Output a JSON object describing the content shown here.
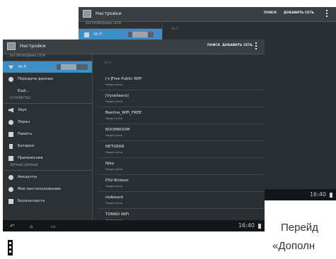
{
  "title": "Настройки",
  "actions": {
    "search": "ПОИСК",
    "add_network": "ДОБАВИТЬ СЕТЬ"
  },
  "clock": "16:40",
  "back_tablet": {
    "section": "БЕСПРОВОДНЫЕ СЕТИ",
    "wifi_label": "Wi-Fi",
    "content_header": "Wi-Fi"
  },
  "sidebar": {
    "sections": [
      "БЕСПРОВОДНЫЕ СЕТИ",
      "УСТРОЙСТВО",
      "ЛИЧНЫЕ ДАННЫЕ"
    ],
    "items": [
      "Wi-Fi",
      "Передача данных",
      "Ещё...",
      "Звук",
      "Экран",
      "Память",
      "Батарея",
      "Приложения",
      "Аккаунты",
      "Мое местоположение",
      "Безопасность"
    ]
  },
  "content_header": "Wi-Fi",
  "networks": [
    {
      "name": "[+]Free Public WiFi",
      "status": "Недоступна"
    },
    {
      "name": "[Vysellaero]",
      "status": "Недоступна"
    },
    {
      "name": "Beeline_WiFi_FREE",
      "status": "Недоступна"
    },
    {
      "name": "BOOMROOM",
      "status": "Недоступна"
    },
    {
      "name": "NETGEAR",
      "status": "Недоступна"
    },
    {
      "name": "Nika",
      "status": "Недоступна"
    },
    {
      "name": "PSV-Rinkom",
      "status": "Недоступна"
    },
    {
      "name": "redbeard",
      "status": "Недоступна"
    },
    {
      "name": "TONNO WiFi",
      "status": "Недоступна"
    }
  ],
  "caption": {
    "line1": "Перейд",
    "line2": "«Дополн"
  }
}
